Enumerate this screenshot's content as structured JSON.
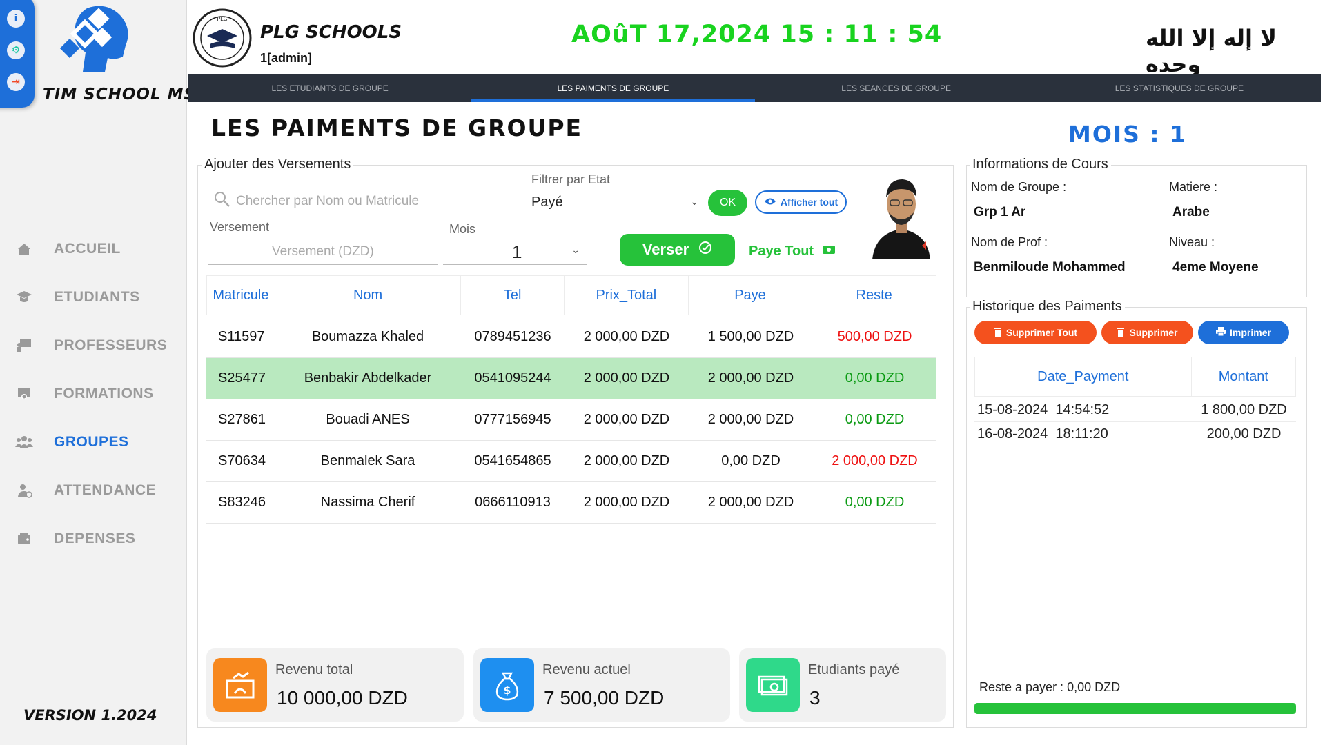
{
  "app": {
    "brand": "TIM SCHOOL MS",
    "version": "VERSION 1.2024"
  },
  "header": {
    "school_name": "PLG SCHOOLS",
    "user": "1[admin]",
    "datetime": "AOûT 17,2024 15 : 11 : 54",
    "arabic_text": "لا إله إلا الله وحده",
    "logo_text": "PLG SCHOOLS"
  },
  "sidebar": {
    "items": [
      {
        "label": "ACCUEIL",
        "icon": "home-icon"
      },
      {
        "label": "ETUDIANTS",
        "icon": "graduation-cap-icon"
      },
      {
        "label": "PROFESSEURS",
        "icon": "teacher-board-icon"
      },
      {
        "label": "FORMATIONS",
        "icon": "certificate-icon"
      },
      {
        "label": "GROUPES",
        "icon": "users-group-icon",
        "active": true
      },
      {
        "label": "ATTENDANCE",
        "icon": "user-check-icon"
      },
      {
        "label": "DEPENSES",
        "icon": "wallet-icon"
      }
    ]
  },
  "tabs": [
    {
      "label": "LES ETUDIANTS DE GROUPE"
    },
    {
      "label": "LES PAIMENTS DE GROUPE",
      "active": true
    },
    {
      "label": "LES SEANCES DE GROUPE"
    },
    {
      "label": "LES STATISTIQUES DE GROUPE"
    }
  ],
  "page": {
    "title": "LES PAIMENTS DE GROUPE",
    "month_label": "MOIS : 1"
  },
  "versements": {
    "legend": "Ajouter des Versements",
    "search_placeholder": "Chercher par Nom ou Matricule",
    "filter_label": "Filtrer par Etat",
    "filter_value": "Payé",
    "ok_label": "OK",
    "show_all_label": "Afficher tout",
    "versement_label": "Versement",
    "versement_placeholder": "Versement (DZD)",
    "mois_label": "Mois",
    "mois_value": "1",
    "verser_label": "Verser",
    "paye_tout_label": "Paye Tout"
  },
  "table": {
    "columns": [
      "Matricule",
      "Nom",
      "Tel",
      "Prix_Total",
      "Paye",
      "Reste"
    ],
    "rows": [
      {
        "matricule": "S11597",
        "nom": "Boumazza Khaled",
        "tel": "0789451236",
        "prix_total": "2 000,00 DZD",
        "paye": "1 500,00 DZD",
        "reste": "500,00 DZD",
        "reste_status": "red"
      },
      {
        "matricule": "S25477",
        "nom": "Benbakir Abdelkader",
        "tel": "0541095244",
        "prix_total": "2 000,00 DZD",
        "paye": "2 000,00 DZD",
        "reste": "0,00 DZD",
        "reste_status": "green",
        "selected": true
      },
      {
        "matricule": "S27861",
        "nom": "Bouadi ANES",
        "tel": "0777156945",
        "prix_total": "2 000,00 DZD",
        "paye": "2 000,00 DZD",
        "reste": "0,00 DZD",
        "reste_status": "green"
      },
      {
        "matricule": "S70634",
        "nom": "Benmalek Sara",
        "tel": "0541654865",
        "prix_total": "2 000,00 DZD",
        "paye": "0,00 DZD",
        "reste": "2 000,00 DZD",
        "reste_status": "red"
      },
      {
        "matricule": "S83246",
        "nom": "Nassima Cherif",
        "tel": "0666110913",
        "prix_total": "2 000,00 DZD",
        "paye": "2 000,00 DZD",
        "reste": "0,00 DZD",
        "reste_status": "green"
      }
    ]
  },
  "stats": [
    {
      "title": "Revenu total",
      "value": "10 000,00 DZD",
      "icon": "revenue-chart-icon",
      "color": "#f7881e"
    },
    {
      "title": "Revenu actuel",
      "value": "7 500,00 DZD",
      "icon": "money-bag-icon",
      "color": "#1e8ff0"
    },
    {
      "title": "Etudiants payé",
      "value": "3",
      "icon": "cash-icon",
      "color": "#2fd98a"
    }
  ],
  "course_info": {
    "legend": "Informations de Cours",
    "groupe_label": "Nom de Groupe :",
    "groupe_value": "Grp 1 Ar",
    "matiere_label": "Matiere :",
    "matiere_value": "Arabe",
    "prof_label": "Nom de Prof :",
    "prof_value": "Benmiloude Mohammed",
    "niveau_label": "Niveau :",
    "niveau_value": "4eme Moyene"
  },
  "history": {
    "legend": "Historique des Paiments",
    "delete_all_label": "Supprimer Tout",
    "delete_label": "Supprimer",
    "print_label": "Imprimer",
    "columns": [
      "Date_Payment",
      "Montant"
    ],
    "rows": [
      {
        "date": "15-08-2024  14:54:52",
        "montant": "1 800,00 DZD"
      },
      {
        "date": "16-08-2024  18:11:20",
        "montant": "200,00 DZD"
      }
    ],
    "reste_text": "Reste a payer : 0,00 DZD",
    "progress": 1.0
  },
  "colors": {
    "accent": "#1e6fd9",
    "green": "#19d31f",
    "tab_bg": "#2a313c",
    "danger": "#f4511e"
  }
}
